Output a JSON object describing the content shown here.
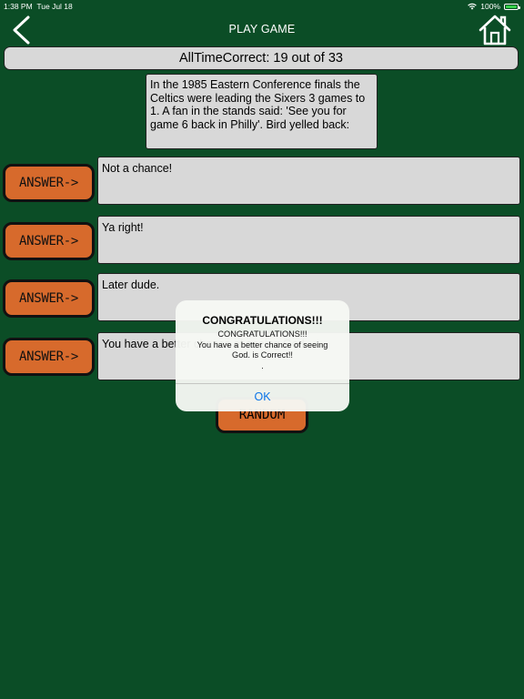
{
  "status": {
    "time": "1:38 PM",
    "date": "Tue Jul 18",
    "battery": "100%"
  },
  "nav": {
    "title": "PLAY GAME"
  },
  "score": {
    "text": "AllTimeCorrect: 19 out of 33"
  },
  "question": {
    "text": "In the 1985 Eastern Conference finals the Celtics were leading the Sixers 3 games to 1. A fan in the stands said: 'See you for game 6 back in Philly'. Bird yelled back:"
  },
  "answers": [
    {
      "button_label": "ANSWER->",
      "text": "Not a chance!"
    },
    {
      "button_label": "ANSWER->",
      "text": "Ya right!"
    },
    {
      "button_label": "ANSWER->",
      "text": "Later dude."
    },
    {
      "button_label": "ANSWER->",
      "text": "You have a better chance of seeing God."
    }
  ],
  "random": {
    "label": "RANDOM"
  },
  "alert": {
    "title": "CONGRATULATIONS!!!",
    "line1": "CONGRATULATIONS!!!",
    "line2": "You have a better chance of seeing",
    "line3": "God. is Correct!!",
    "line4": ".",
    "ok_label": "OK"
  },
  "colors": {
    "background": "#0b4d26",
    "answer_button": "#d76a2c",
    "panel": "#d8d8d8",
    "battery": "#36d14a",
    "alert_ok": "#0a74e8"
  },
  "icons": {
    "back": "chevron-left-icon",
    "home": "home-icon",
    "wifi": "wifi-icon",
    "battery": "battery-icon"
  }
}
